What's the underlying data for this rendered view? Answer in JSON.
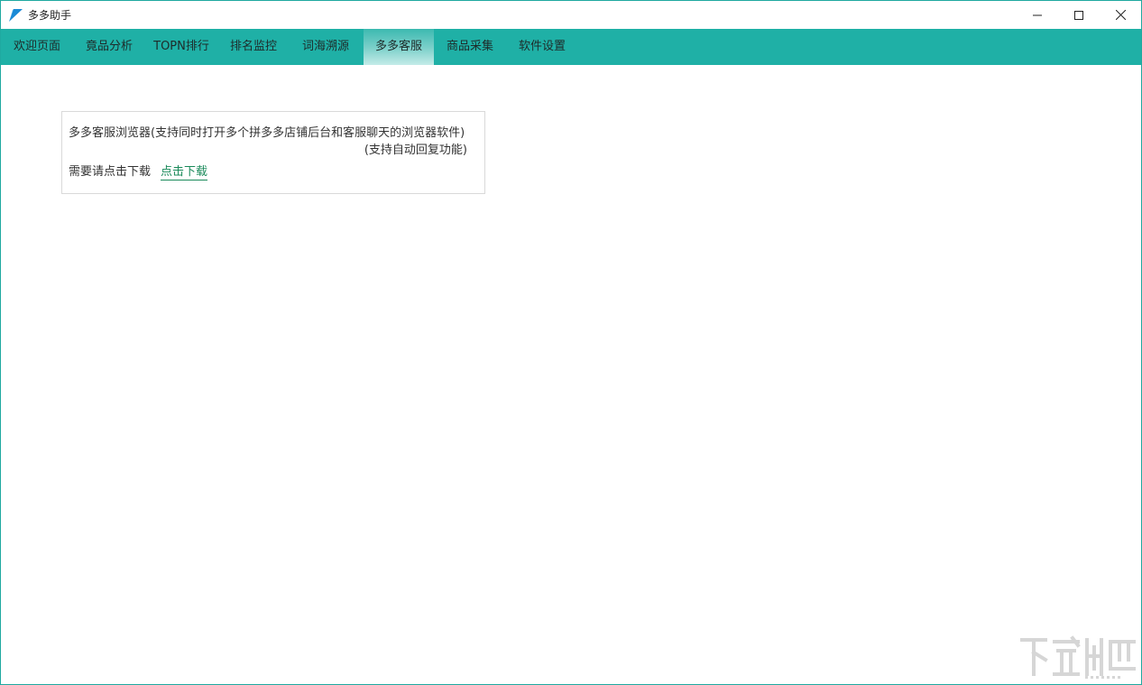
{
  "window": {
    "title": "多多助手",
    "controls": {
      "minimize_icon": "minimize-icon",
      "maximize_icon": "maximize-icon",
      "close_icon": "close-icon"
    }
  },
  "nav": {
    "tabs": [
      {
        "label": "欢迎页面",
        "active": false
      },
      {
        "label": "竟品分析",
        "active": false
      },
      {
        "label": "TOPN排行",
        "active": false
      },
      {
        "label": "排名监控",
        "active": false
      },
      {
        "label": "词海溯源",
        "active": false
      },
      {
        "label": "多多客服",
        "active": true
      },
      {
        "label": "商品采集",
        "active": false
      },
      {
        "label": "软件设置",
        "active": false
      }
    ]
  },
  "panel": {
    "description_line1": "多多客服浏览器(支持同时打开多个拼多多店铺后台和客服聊天的浏览器软件)",
    "description_line2": "(支持自动回复功能)",
    "download_prompt": "需要请点击下载",
    "download_link": "点击下载"
  },
  "colors": {
    "accent": "#1fb0a6",
    "link": "#1a8a5a"
  }
}
